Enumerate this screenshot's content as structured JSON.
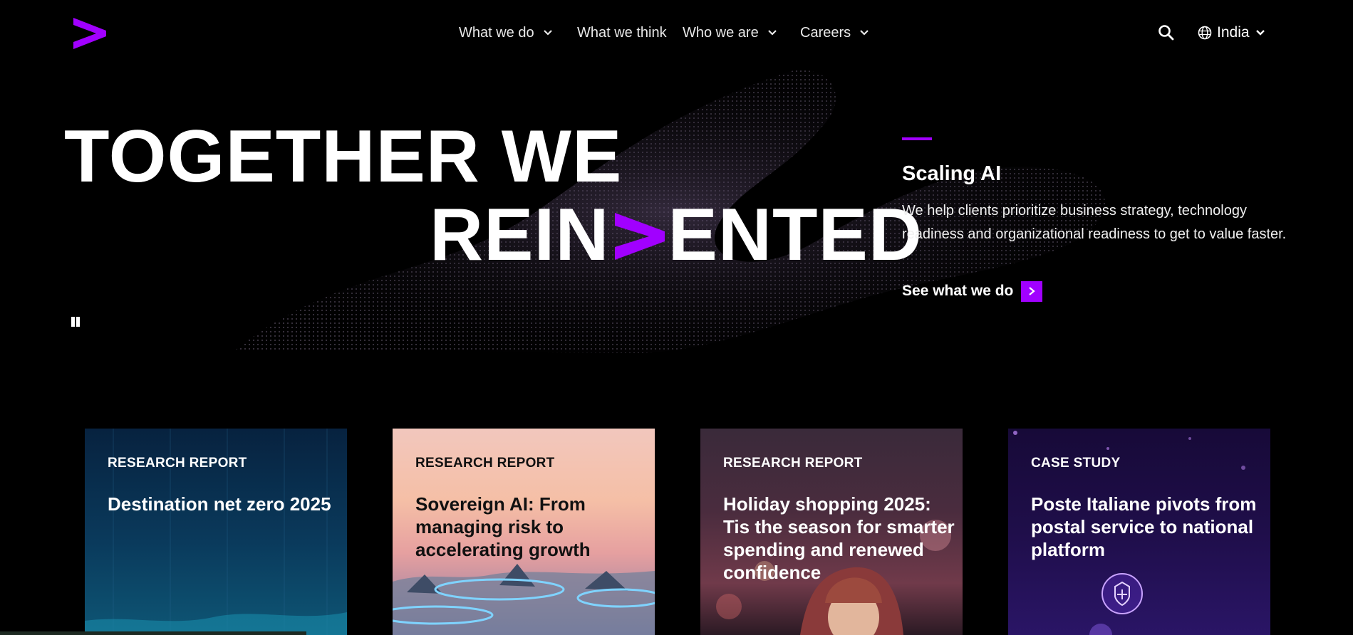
{
  "brand": {
    "name": "Accenture",
    "accent": "#a100ff"
  },
  "nav": {
    "items": [
      {
        "label": "What we do",
        "dropdown": true
      },
      {
        "label": "What we think",
        "dropdown": false
      },
      {
        "label": "Who we are",
        "dropdown": true
      },
      {
        "label": "Careers",
        "dropdown": true
      }
    ],
    "search_icon": "search-icon",
    "locale": {
      "label": "India",
      "icon": "globe-icon"
    }
  },
  "hero": {
    "headline_line1": "TOGETHER WE",
    "headline_line2_left": "REIN",
    "headline_line2_right": "ENTED",
    "pause_icon": "pause-icon",
    "feature": {
      "title": "Scaling AI",
      "description": "We help clients prioritize business strategy, technology readiness and organizational readiness to get to value faster.",
      "cta_label": "See what we do"
    }
  },
  "cards": [
    {
      "kicker": "RESEARCH REPORT",
      "title": "Destination net zero 2025"
    },
    {
      "kicker": "RESEARCH REPORT",
      "title": "Sovereign AI: From managing risk to accelerating growth"
    },
    {
      "kicker": "RESEARCH REPORT",
      "title": "Holiday shopping 2025: Tis the season for smarter spending and renewed confidence"
    },
    {
      "kicker": "CASE STUDY",
      "title": "Poste Italiane pivots from postal service to national platform"
    }
  ]
}
